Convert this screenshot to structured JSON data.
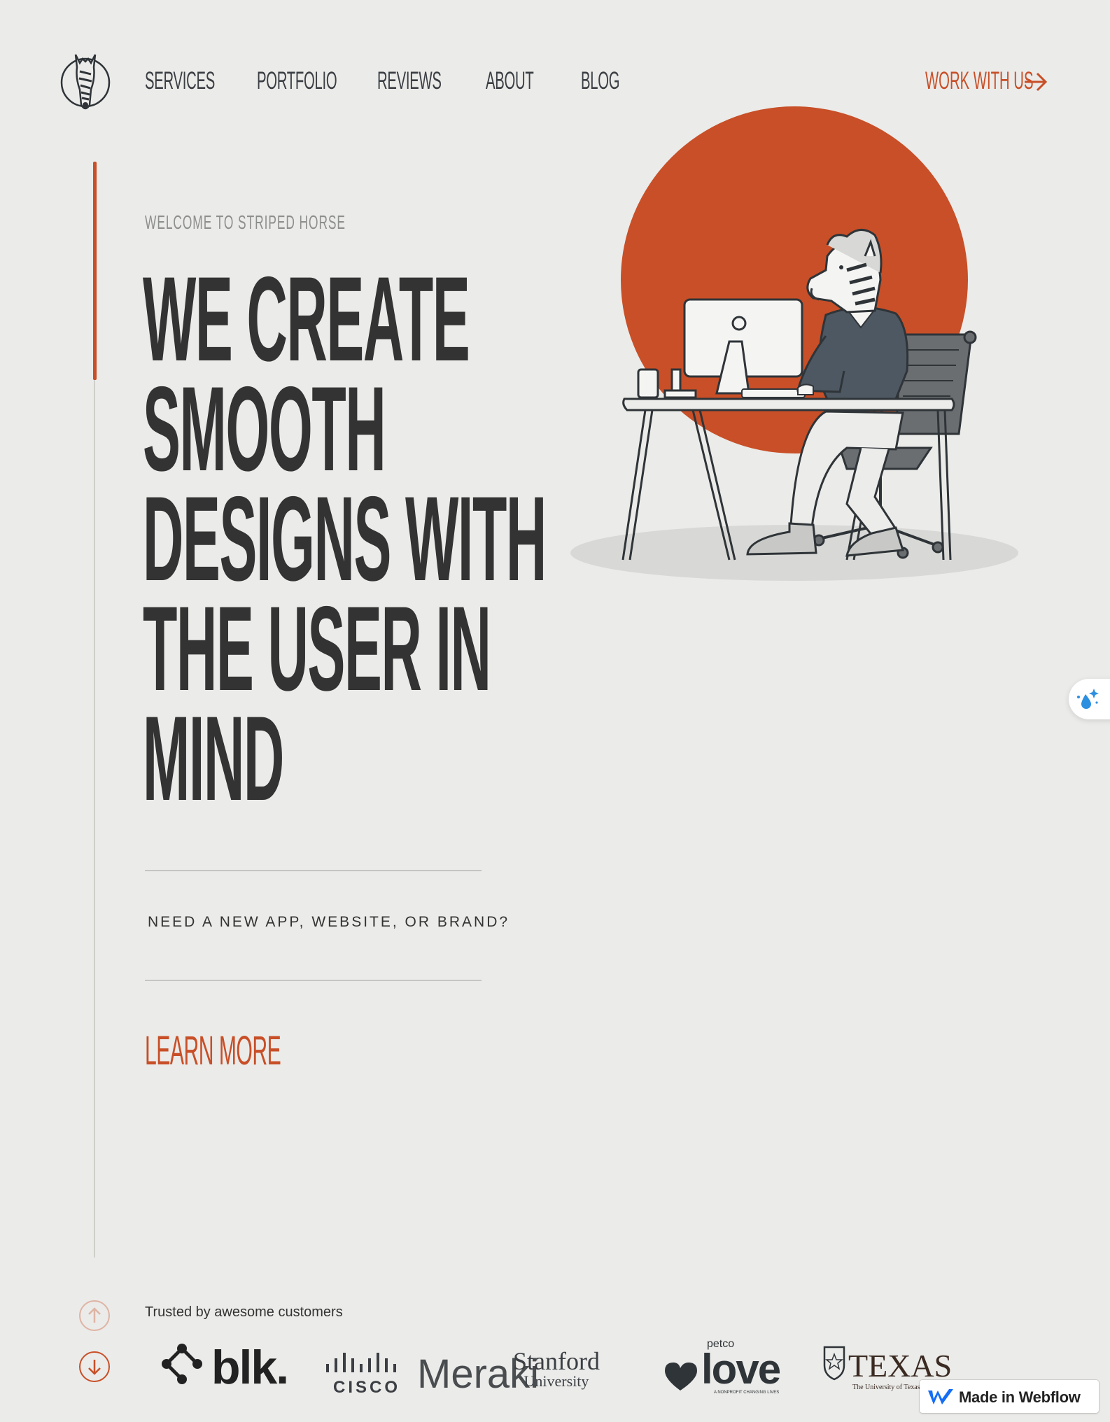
{
  "brand": {
    "logo_icon": "striped-horse-logo",
    "accent": "#c84f27",
    "background": "#ebebe9",
    "text": "#333333"
  },
  "nav": {
    "items": [
      {
        "label": "SERVICES"
      },
      {
        "label": "PORTFOLIO"
      },
      {
        "label": "REVIEWS"
      },
      {
        "label": "ABOUT"
      },
      {
        "label": "BLOG"
      }
    ],
    "cta": {
      "label": "WORK WITH US",
      "icon": "arrow-right-icon"
    }
  },
  "hero": {
    "kicker": "WELCOME TO STRIPED HORSE",
    "headline_lines": [
      "WE CREATE",
      "SMOOTH",
      "DESIGNS WITH",
      "THE USER IN",
      "MIND"
    ],
    "tagline": "NEED A NEW APP, WEBSITE, OR BRAND?",
    "learn_more": "LEARN MORE",
    "illustration": "zebra-at-desk-illustration"
  },
  "customers": {
    "heading": "Trusted by awesome customers",
    "logos": [
      {
        "name": "blk",
        "text": "blk."
      },
      {
        "name": "cisco",
        "text": "CISCO"
      },
      {
        "name": "meraki",
        "text": "Meraki"
      },
      {
        "name": "stanford",
        "text": "Stanford",
        "sub": "University"
      },
      {
        "name": "petco-love",
        "text": "love",
        "top": "petco",
        "sub": "A NONPROFIT CHANGING LIVES"
      },
      {
        "name": "texas",
        "text": "TEXAS",
        "sub": "The University of Texas at Austin"
      }
    ]
  },
  "scroll": {
    "up_icon": "arrow-up-icon",
    "down_icon": "arrow-down-icon"
  },
  "widget": {
    "icon": "droplet-sparkle-icon"
  },
  "webflow_badge": {
    "label": "Made in Webflow",
    "icon": "webflow-icon"
  }
}
